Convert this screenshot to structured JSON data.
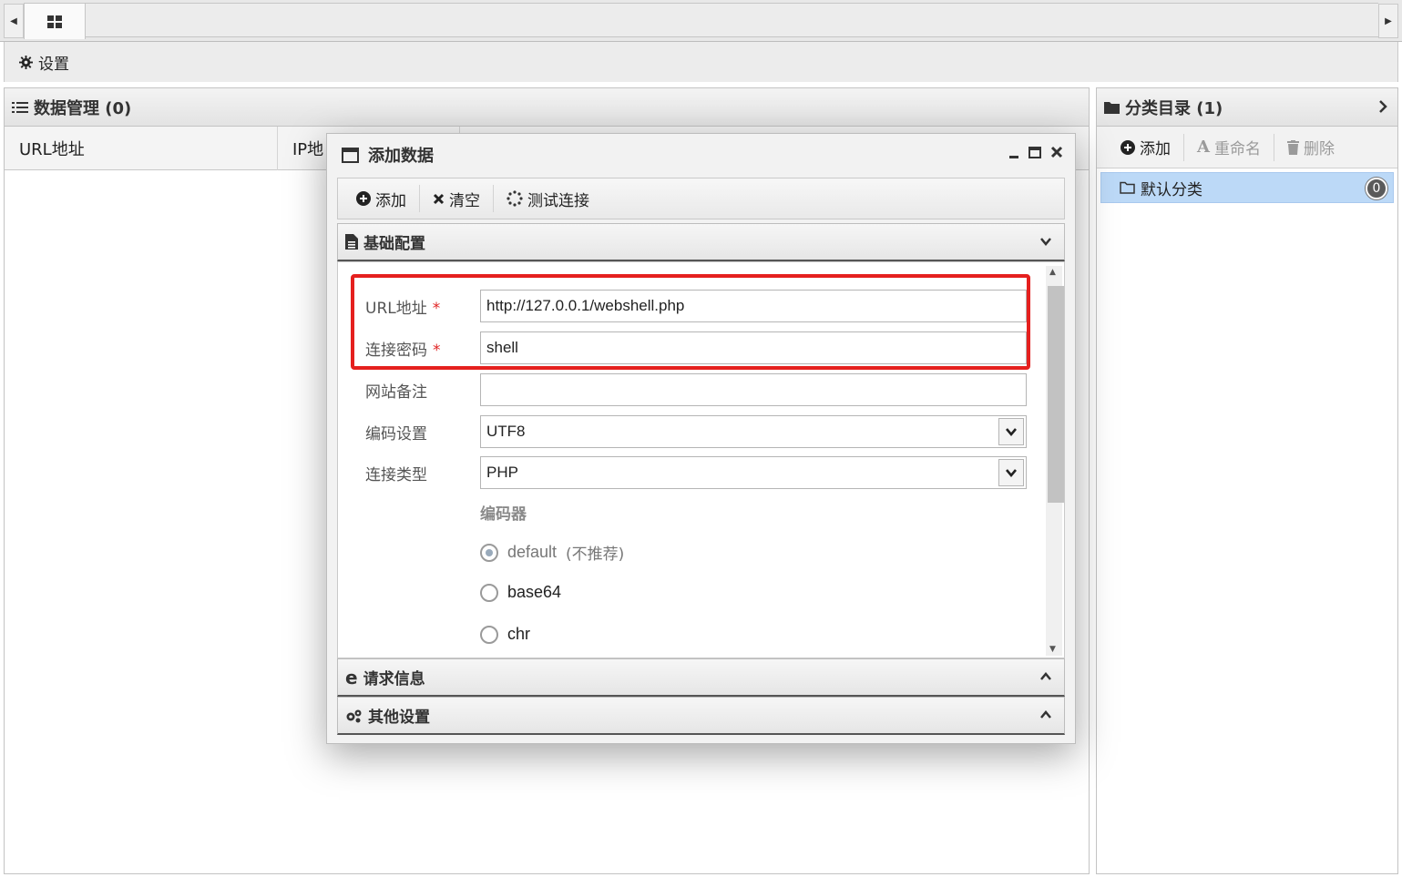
{
  "settings": {
    "label": "设置"
  },
  "data_panel": {
    "title": "数据管理 (0)",
    "columns": [
      "URL地址",
      "IP地"
    ]
  },
  "category_panel": {
    "title": "分类目录 (1)",
    "toolbar": {
      "add": "添加",
      "rename": "重命名",
      "delete": "删除"
    },
    "items": [
      {
        "label": "默认分类",
        "count": "0"
      }
    ]
  },
  "dialog": {
    "title": "添加数据",
    "toolbar": {
      "add": "添加",
      "clear": "清空",
      "test": "测试连接"
    },
    "sections": {
      "basic": "基础配置",
      "request": "请求信息",
      "other": "其他设置"
    },
    "form": {
      "url_label": "URL地址",
      "url_value": "http://127.0.0.1/webshell.php",
      "password_label": "连接密码",
      "password_value": "shell",
      "note_label": "网站备注",
      "note_value": "",
      "encoding_label": "编码设置",
      "encoding_value": "UTF8",
      "type_label": "连接类型",
      "type_value": "PHP",
      "encoder_label": "编码器",
      "encoders": [
        {
          "name": "default",
          "hint": "(不推荐)",
          "selected": true
        },
        {
          "name": "base64",
          "hint": "",
          "selected": false
        },
        {
          "name": "chr",
          "hint": "",
          "selected": false
        }
      ],
      "required_mark": "*"
    }
  },
  "colors": {
    "highlight": "#e5201e",
    "selected_item": "#bcd9f7",
    "required": "#e02424"
  }
}
